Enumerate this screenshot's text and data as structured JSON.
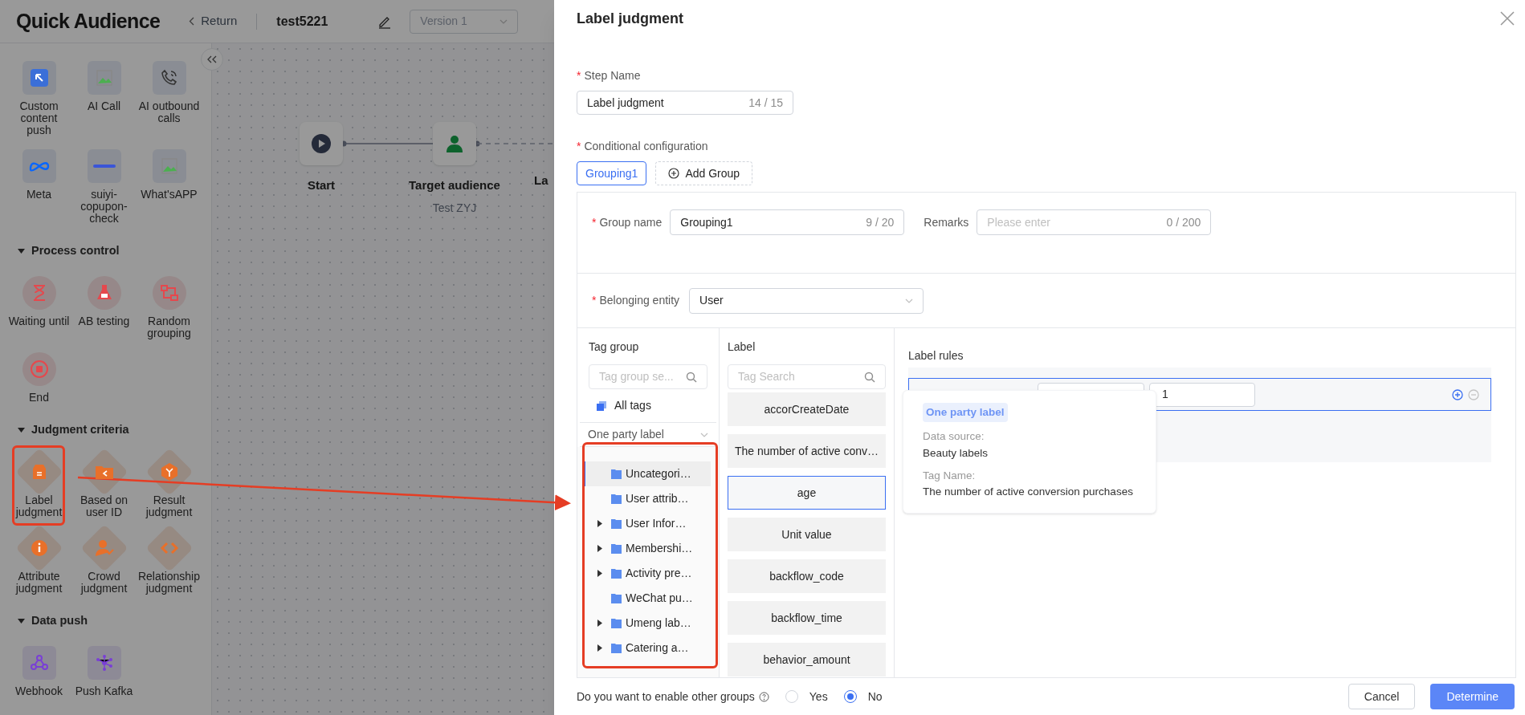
{
  "app": {
    "logo": "Quick Audience",
    "back": "Return",
    "title": "test5221",
    "version": "Version 1"
  },
  "sidebar": {
    "sections": [
      {
        "items": [
          "Custom content push",
          "AI Call",
          "AI outbound calls",
          "Meta",
          "suiyi-copupon-check",
          "What'sAPP"
        ]
      },
      {
        "title": "Process control",
        "expanded": true,
        "items": [
          "Waiting until",
          "AB testing",
          "Random grouping",
          "End"
        ]
      },
      {
        "title": "Judgment criteria",
        "expanded": true,
        "items": [
          "Label judgment",
          "Based on user ID",
          "Result judgment",
          "Attribute judgment",
          "Crowd judgment",
          "Relationship judgment"
        ]
      },
      {
        "title": "Data push",
        "expanded": true,
        "items": [
          "Webhook",
          "Push Kafka"
        ]
      }
    ]
  },
  "canvas": {
    "nodes": [
      {
        "kind": "start",
        "title": "Start"
      },
      {
        "kind": "audience",
        "title": "Target audience",
        "subtitle": "Test ZYJ"
      },
      {
        "kind": "hidden",
        "title": "La"
      }
    ]
  },
  "drawer": {
    "title": "Label judgment",
    "step_name": {
      "label": "Step Name",
      "required": true,
      "required_mark": "*",
      "value": "Label judgment",
      "counter": "14 / 15"
    },
    "conditional": {
      "label": "Conditional configuration",
      "required": true,
      "required_mark": "*",
      "tabs": [
        {
          "label": "Grouping1",
          "selected": true
        }
      ],
      "add_group": "Add Group"
    },
    "group_name": {
      "label": "Group name",
      "required": true,
      "required_mark": "*",
      "value": "Grouping1",
      "counter": "9 / 20"
    },
    "remarks": {
      "label": "Remarks",
      "placeholder": "Please enter",
      "counter": "0 / 200"
    },
    "entity": {
      "label": "Belonging entity",
      "required": true,
      "required_mark": "*",
      "value": "User"
    },
    "tag_group": {
      "title": "Tag group",
      "search_placeholder": "Tag group se...",
      "all_tags": "All tags",
      "category": "One party label",
      "tree": [
        {
          "label": "Uncategori…",
          "expandable": false,
          "selected": true
        },
        {
          "label": "User attrib…",
          "expandable": false,
          "selected": false
        },
        {
          "label": "User Infor…",
          "expandable": true,
          "selected": false
        },
        {
          "label": "Membershi…",
          "expandable": true,
          "selected": false
        },
        {
          "label": "Activity pre…",
          "expandable": true,
          "selected": false
        },
        {
          "label": "WeChat pu…",
          "expandable": false,
          "selected": false
        },
        {
          "label": "Umeng lab…",
          "expandable": true,
          "selected": false
        },
        {
          "label": "Catering a…",
          "expandable": true,
          "selected": false
        }
      ]
    },
    "labels": {
      "title": "Label",
      "search_placeholder": "Tag Search",
      "items": [
        {
          "label": "accorCreateDate",
          "selected": false
        },
        {
          "label": "The number of active conv…",
          "selected": false
        },
        {
          "label": "age",
          "selected": true
        },
        {
          "label": "Unit value",
          "selected": false
        },
        {
          "label": "backflow_code",
          "selected": false
        },
        {
          "label": "backflow_time",
          "selected": false
        },
        {
          "label": "behavior_amount",
          "selected": false
        }
      ]
    },
    "rules": {
      "title": "Label rules",
      "rows": [
        {
          "value": "1"
        }
      ]
    },
    "popover": {
      "tag": "One party label",
      "fields": [
        {
          "label": "Data source:",
          "value": "Beauty labels"
        },
        {
          "label": "Tag Name:",
          "value": "The number of active conversion purchases"
        }
      ]
    },
    "footer": {
      "question": "Do you want to enable other groups",
      "options": [
        {
          "label": "Yes",
          "selected": false
        },
        {
          "label": "No",
          "selected": true
        }
      ],
      "cancel": "Cancel",
      "confirm": "Determine"
    }
  }
}
